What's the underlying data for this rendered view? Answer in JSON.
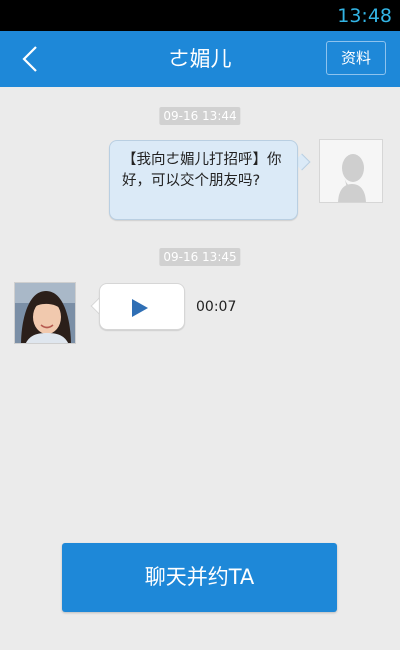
{
  "status_bar": {
    "time": "13:48"
  },
  "header": {
    "title": "ㄜ媚儿",
    "profile_label": "资料",
    "back_icon": "chevron-left-icon"
  },
  "messages": [
    {
      "timestamp": "09-16 13:44",
      "direction": "outgoing",
      "type": "text",
      "text": "【我向ㄜ媚儿打招呼】你好，可以交个朋友吗?"
    },
    {
      "timestamp": "09-16 13:45",
      "direction": "incoming",
      "type": "voice",
      "duration": "00:07"
    }
  ],
  "footer": {
    "chat_button_label": "聊天并约TA"
  },
  "colors": {
    "primary": "#1e88d8",
    "status_time": "#33b5e5",
    "background": "#ebebeb",
    "bubble_outgoing": "#dbeaf7"
  }
}
